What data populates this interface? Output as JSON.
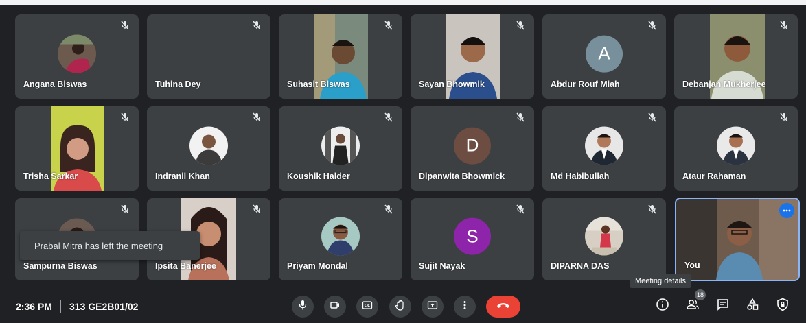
{
  "participants": [
    {
      "name": "Angana Biswas"
    },
    {
      "name": "Tuhina Dey"
    },
    {
      "name": "Suhasit Biswas"
    },
    {
      "name": "Sayan Bhowmik"
    },
    {
      "name": "Abdur Rouf Miah",
      "initial": "A",
      "avatar_color": "#78909c"
    },
    {
      "name": "Debanjan Mukherjee"
    },
    {
      "name": "Trisha Sarkar"
    },
    {
      "name": "Indranil Khan"
    },
    {
      "name": "Koushik Halder"
    },
    {
      "name": "Dipanwita Bhowmick",
      "initial": "D",
      "avatar_color": "#6d4c41"
    },
    {
      "name": "Md Habibullah"
    },
    {
      "name": "Ataur Rahaman"
    },
    {
      "name": "Sampurna Biswas"
    },
    {
      "name": "Ipsita Banerjee"
    },
    {
      "name": "Priyam Mondal"
    },
    {
      "name": "Sujit Nayak",
      "initial": "S",
      "avatar_color": "#8e24aa"
    },
    {
      "name": "DIPARNA DAS"
    },
    {
      "name": "You"
    }
  ],
  "toast": {
    "text": "Prabal Mitra has left the meeting"
  },
  "tooltip": {
    "text": "Meeting details"
  },
  "bottom_bar": {
    "time": "2:36 PM",
    "meeting_code": "313 GE2B01/02",
    "participant_count": "18"
  },
  "colors": {
    "background": "#202124",
    "tile": "#3c4043",
    "hangup": "#ea4335",
    "selected_border": "#8ab4f8",
    "accent_blue": "#1a73e8"
  }
}
